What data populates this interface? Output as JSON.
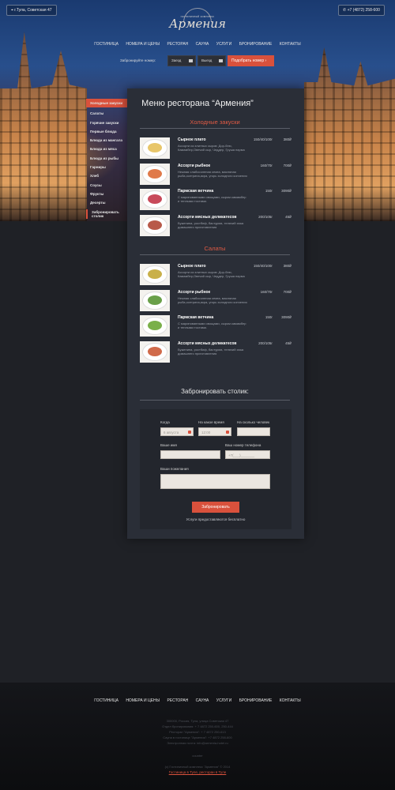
{
  "header": {
    "address": "г.Тула, Советская 47",
    "phone": "+7 (4872) 258-600",
    "logo_subtitle": "гостиничный комплекс",
    "logo_title": "Армения",
    "nav": [
      "ГОСТИНИЦА",
      "НОМЕРА И ЦЕНЫ",
      "РЕСТОРАН",
      "САУНА",
      "УСЛУГИ",
      "БРОНИРОВАНИЕ",
      "КОНТАКТЫ"
    ]
  },
  "booking": {
    "label": "Забронируйте номер:",
    "checkin": "Заезд",
    "checkout": "Выезд",
    "button": "Подобрать номер"
  },
  "sidebar": {
    "items": [
      "Холодные закуски",
      "Салаты",
      "Горячие закуски",
      "Первые блюда",
      "Блюда из мангала",
      "Блюда из мяса",
      "Блюда из рыбы",
      "Гарниры",
      "Хлеб",
      "Соусы",
      "Фрукты",
      "Десерты",
      "Забронировать столик"
    ]
  },
  "main": {
    "title": "Меню ресторана “Армения”",
    "sections": [
      {
        "title": "Холодные закуски",
        "dishes": [
          {
            "name": "Сырное плато",
            "desc": "Ассорти из элитных сыров: Дор-блю, Камамбер,Овечий сыр, Чеддер, Груша парма",
            "weight": "150/40/100г",
            "price": "380₽",
            "color": "#e8c66a"
          },
          {
            "name": "Ассорти рыбное",
            "desc": "Нежная слабосоленая семга, масляная рыба,осетрина,икра, угорь холодного копчения",
            "weight": "160/70г",
            "price": "700₽",
            "color": "#e07a4a"
          },
          {
            "name": "Пармская ветчина",
            "desc": "С маринованными овощами, сыром камамбер и теплыми тостами.",
            "weight": "150г",
            "price": "3090₽",
            "color": "#c84a5a"
          },
          {
            "name": "Ассорти мясных деликатесов",
            "desc": "Буженина, ростбиф, бастурма, телячий язык домашнего приготовления",
            "weight": "200/105г",
            "price": "45₽",
            "color": "#b85a4a"
          }
        ]
      },
      {
        "title": "Салаты",
        "dishes": [
          {
            "name": "Сырное плато",
            "desc": "Ассорти из элитных сыров: Дор-блю, Камамбер,Овечий сыр, Чеддер, Груша парма",
            "weight": "150/40/100г",
            "price": "380₽",
            "color": "#c9b04a"
          },
          {
            "name": "Ассорти рыбное",
            "desc": "Нежная слабосоленая семга, масляная рыба,осетрина,икра, угорь холодного копчения",
            "weight": "160/70г",
            "price": "700₽",
            "color": "#6aa04a"
          },
          {
            "name": "Пармская ветчина",
            "desc": "С маринованными овощами, сыром камамбер и теплыми тостами.",
            "weight": "150г",
            "price": "3090₽",
            "color": "#7ab04a"
          },
          {
            "name": "Ассорти мясных деликатесов",
            "desc": "Буженина, ростбиф, бастурма, телячий язык домашнего приготовления",
            "weight": "200/105г",
            "price": "45₽",
            "color": "#d06a4a"
          }
        ]
      }
    ]
  },
  "reservation": {
    "title": "Забронировать столик:",
    "when_label": "Когда",
    "when_value": "6 августа",
    "time_label": "На какое время",
    "time_value": "12:00",
    "people_label": "На сколько человек",
    "name_label": "Ваше имя",
    "phone_label": "Ваш номер телефона",
    "phone_placeholder": "+7(___)_______",
    "wishes_label": "Ваши пожелания",
    "button": "Забронировать",
    "note": "Услуги предоставляются бесплатно"
  },
  "footer": {
    "nav": [
      "ГОСТИНИЦА",
      "НОМЕРА И ЦЕНЫ",
      "РЕСТОРАН",
      "САУНА",
      "УСЛУГИ",
      "БРОНИРОВАНИЕ",
      "КОНТАКТЫ"
    ],
    "info": [
      "300000, Россия, Тула, улица Советская 47",
      "Отдел бронирования: + 7 4872 250-600, 250-444",
      "Ресторан \"Армения\": + 7 4872 250-613",
      "Сауна в гостинице \"Армения\": +7 4872 258-600",
      "Электронная почта: info@armenia-hotel.ru"
    ],
    "counter": "counter",
    "copyright": "(с) Гостиничный комплекс \"Армения\" © 2014",
    "link": "Гостиница в Туле, ресторан в Туле"
  },
  "colors": {
    "accent": "#d9513c",
    "panel": "#2a2e37",
    "background": "#1f2126"
  }
}
